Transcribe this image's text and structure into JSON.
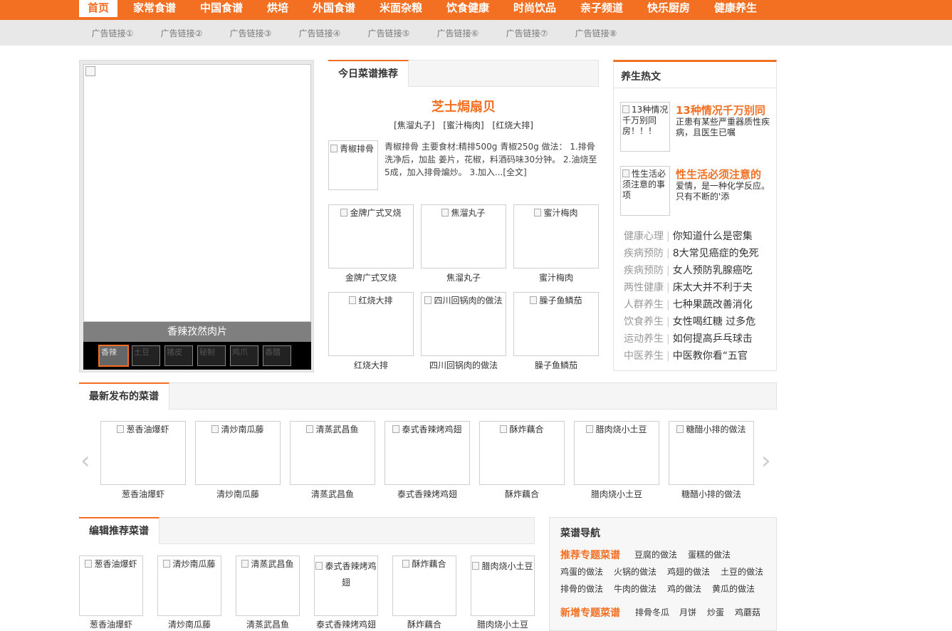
{
  "top_nav": [
    "首页",
    "家常食谱",
    "中国食谱",
    "烘培",
    "外国食谱",
    "米面杂粮",
    "饮食健康",
    "时尚饮品",
    "亲子频道",
    "快乐厨房",
    "健康养生"
  ],
  "sub_nav": [
    "广告链接①",
    "广告链接②",
    "广告链接③",
    "广告链接④",
    "广告链接⑤",
    "广告链接⑥",
    "广告链接⑦",
    "广告链接⑧"
  ],
  "slideshow": {
    "caption": "香辣孜然肉片",
    "thumbs": [
      "香辣",
      "土豆",
      "猪皮",
      "秘制",
      "鸡爪",
      "香醋"
    ]
  },
  "today": {
    "tab": "今日菜谱推荐",
    "title": "芝士焗扇贝",
    "links": [
      "[焦溜丸子]",
      "[蜜汁梅肉]",
      "[红烧大排]"
    ],
    "feature_img": "青椒排骨",
    "feature_text": "青椒排骨 主要食材:精排500g 青椒250g 做法： 1.排骨洗净后，加盐 姜片，花椒，料酒码味30分钟。 2.油烧至5成，加入排骨煸炒。 3.加入...",
    "feature_more": "[全文]",
    "items": [
      "金牌广式叉烧",
      "焦溜丸子",
      "蜜汁梅肉",
      "红烧大排",
      "四川回锅肉的做法",
      "臊子鱼鳞茄"
    ]
  },
  "health": {
    "title": "养生热文",
    "features": [
      {
        "img": "13种情况千万别同房！！！",
        "title": "13种情况千万别同",
        "desc": "正患有某些严重器质性疾病，且医生已嘱"
      },
      {
        "img": "性生活必须注意的事项",
        "title": "性生活必须注意的",
        "desc": "爱情，是一种化学反应。只有不断的'添"
      }
    ],
    "rows": [
      {
        "cat": "健康心理",
        "text": "你知道什么是密集"
      },
      {
        "cat": "疾病预防",
        "text": "8大常见癌症的免死"
      },
      {
        "cat": "疾病预防",
        "text": "女人预防乳腺癌吃"
      },
      {
        "cat": "两性健康",
        "text": "床太大并不利于夫"
      },
      {
        "cat": "人群养生",
        "text": "七种果蔬改善消化"
      },
      {
        "cat": "饮食养生",
        "text": "女性喝红糖 过多危"
      },
      {
        "cat": "运动养生",
        "text": "如何提高乒乓球击"
      },
      {
        "cat": "中医养生",
        "text": "中医教你看“五官"
      }
    ]
  },
  "latest": {
    "tab": "最新发布的菜谱",
    "items": [
      "葱香油爆虾",
      "清炒南瓜藤",
      "清蒸武昌鱼",
      "泰式香辣烤鸡翅",
      "酥炸藕合",
      "腊肉烧小土豆",
      "糖醋小排的做法"
    ],
    "prev": "‹",
    "next": "›"
  },
  "editor": {
    "tab": "编辑推荐菜谱",
    "items": [
      "葱香油爆虾",
      "清炒南瓜藤",
      "清蒸武昌鱼",
      "泰式香辣烤鸡翅",
      "酥炸藕合",
      "腊肉烧小土豆"
    ]
  },
  "recipe_nav": {
    "title": "菜谱导航",
    "rec_label": "推荐专题菜谱",
    "rec_links": [
      "豆腐的做法",
      "蛋糕的做法",
      "鸡蛋的做法",
      "火锅的做法",
      "鸡翅的做法",
      "土豆的做法",
      "排骨的做法",
      "牛肉的做法",
      "鸡的做法",
      "黄瓜的做法"
    ],
    "new_label": "新增专题菜谱",
    "new_links": [
      "排骨冬瓜",
      "月饼",
      "炒蛋",
      "鸡蘑菇"
    ]
  },
  "colors": {
    "accent": "#f36f21"
  }
}
